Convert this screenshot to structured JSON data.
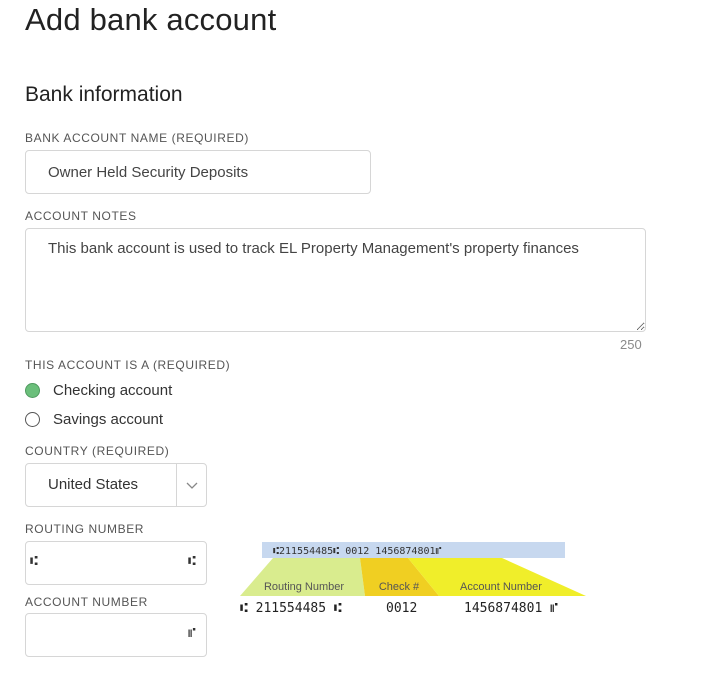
{
  "page": {
    "title": "Add bank account"
  },
  "section": {
    "title": "Bank information"
  },
  "account_name": {
    "label": "BANK ACCOUNT NAME (REQUIRED)",
    "value": "Owner Held Security Deposits"
  },
  "account_notes": {
    "label": "ACCOUNT NOTES",
    "value": "This bank account is used to track EL Property Management's property finances",
    "char_count": "250"
  },
  "account_type": {
    "label": "THIS ACCOUNT IS A (REQUIRED)",
    "options": [
      {
        "label": "Checking account",
        "selected": true
      },
      {
        "label": "Savings account",
        "selected": false
      }
    ]
  },
  "country": {
    "label": "COUNTRY (REQUIRED)",
    "value": "United States",
    "icon": "chevron-down-icon"
  },
  "routing": {
    "label": "ROUTING NUMBER",
    "value": "",
    "prefix_symbol": "⑆",
    "suffix_symbol": "⑆"
  },
  "account_number": {
    "label": "ACCOUNT NUMBER",
    "value": "",
    "suffix_symbol": "⑈"
  },
  "check_diagram": {
    "top_line": "⑆211554485⑆   0012    1456874801⑈",
    "routing_label": "Routing Number",
    "check_label": "Check #",
    "account_label": "Account Number",
    "routing_value": "⑆ 211554485 ⑆",
    "check_value": "0012",
    "account_value": "1456874801 ⑈",
    "colors": {
      "top_band": "#c7d8ef",
      "routing": "#d9ec8e",
      "check": "#f0cf22",
      "account": "#f0ee2a"
    }
  }
}
